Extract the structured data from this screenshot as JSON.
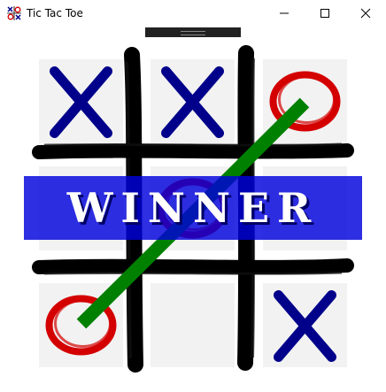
{
  "window": {
    "title": "Tic Tac Toe",
    "icon": "tic-tac-toe-app-icon",
    "controls": [
      "minimize-icon",
      "maximize-icon",
      "close-icon"
    ]
  },
  "game": {
    "board": [
      [
        "X",
        "X",
        "O"
      ],
      [
        "",
        "O",
        ""
      ],
      [
        "O",
        "",
        "X"
      ]
    ],
    "winner_banner": "WINNER",
    "winning_line": "anti-diagonal"
  },
  "colors": {
    "x_mark": "#00008b",
    "o_mark": "#d40000",
    "grid": "#000000",
    "cell_bg": "#f2f2f2",
    "win_line": "#008000",
    "banner_bg": "#0000dc",
    "banner_text": "#ffffff"
  }
}
